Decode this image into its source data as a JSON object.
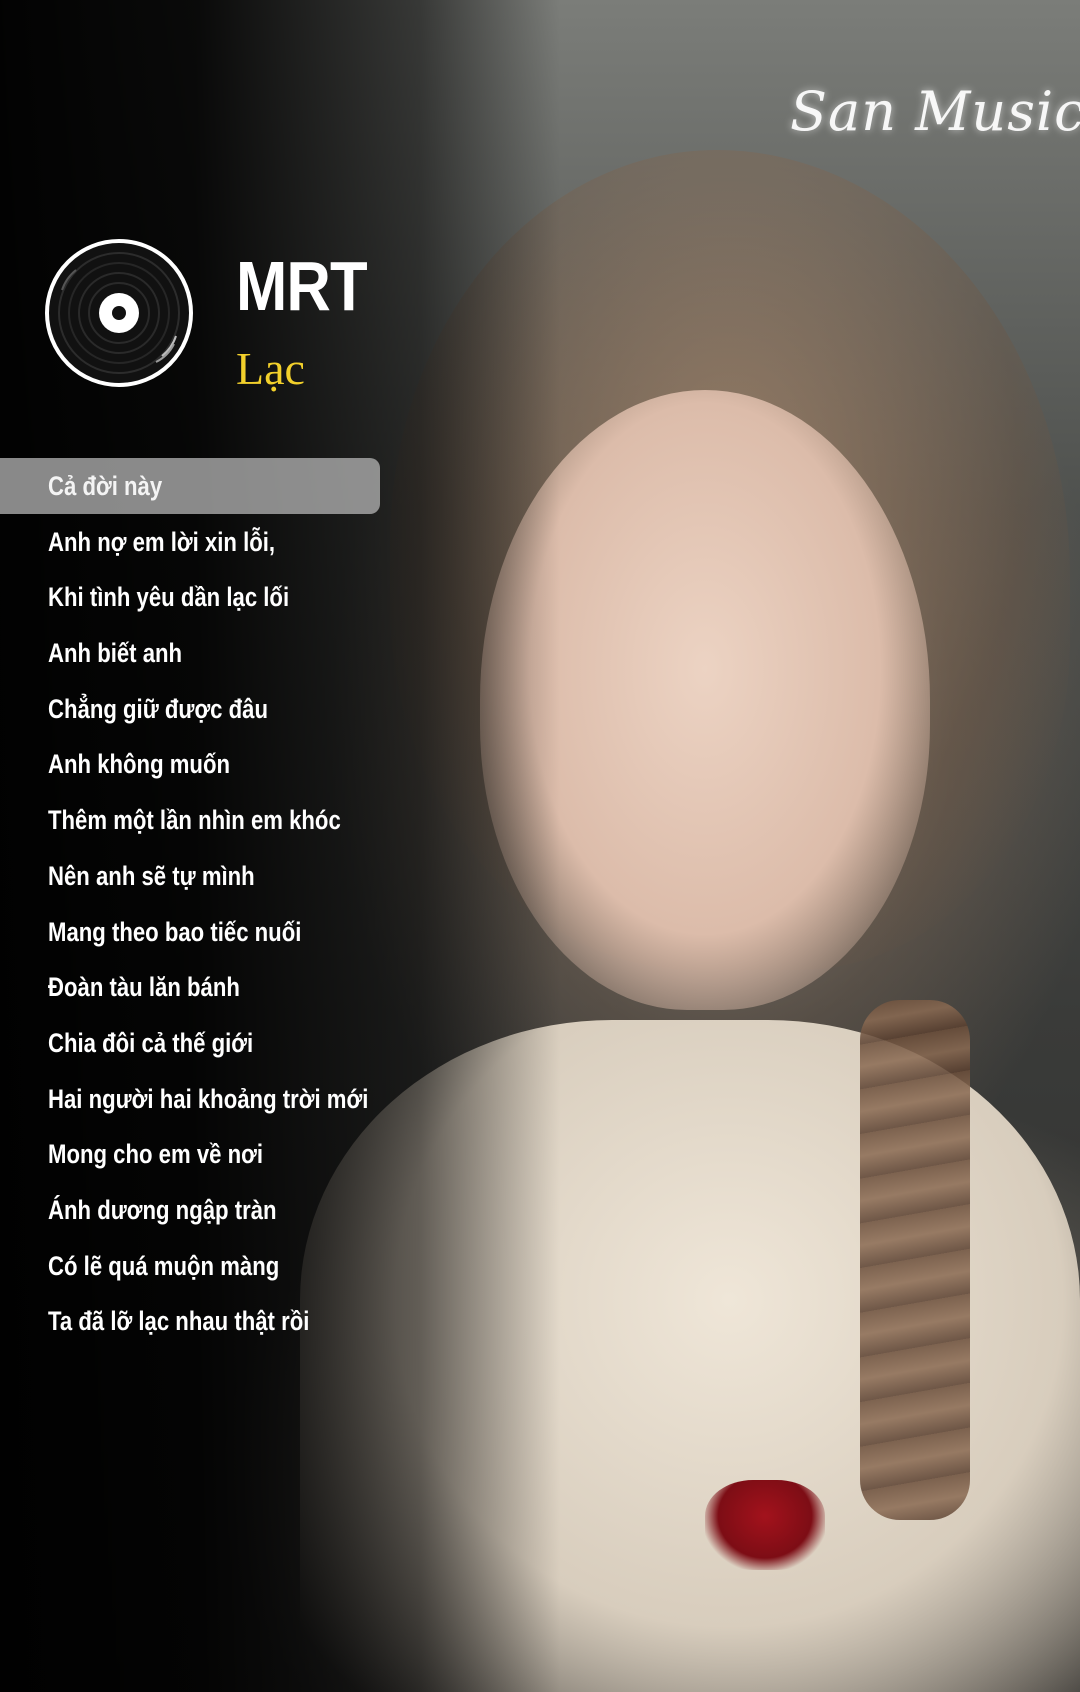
{
  "watermark": "San Music",
  "track": {
    "artist": "MRT",
    "title": "Lạc"
  },
  "icons": {
    "record": "vinyl-record-icon"
  },
  "colors": {
    "title_yellow": "#f2d02b",
    "lyric_text": "#ffffff",
    "active_highlight": "#afafaf"
  },
  "lyrics": {
    "active_index": 0,
    "lines": [
      "Cả đời này",
      "Anh nợ em lời xin lỗi,",
      "Khi tình yêu dần lạc lối",
      "Anh biết anh",
      "Chẳng giữ được đâu",
      "Anh không muốn",
      "Thêm một lần nhìn em khóc",
      "Nên anh sẽ tự mình",
      "Mang theo bao tiếc nuối",
      "Đoàn tàu lăn bánh",
      "Chia đôi cả thế giới",
      "Hai người hai khoảng trời mới",
      "Mong cho em về nơi",
      "Ánh dương ngập tràn",
      "Có lẽ quá muộn màng",
      "Ta đã lỡ lạc nhau thật rồi"
    ]
  }
}
